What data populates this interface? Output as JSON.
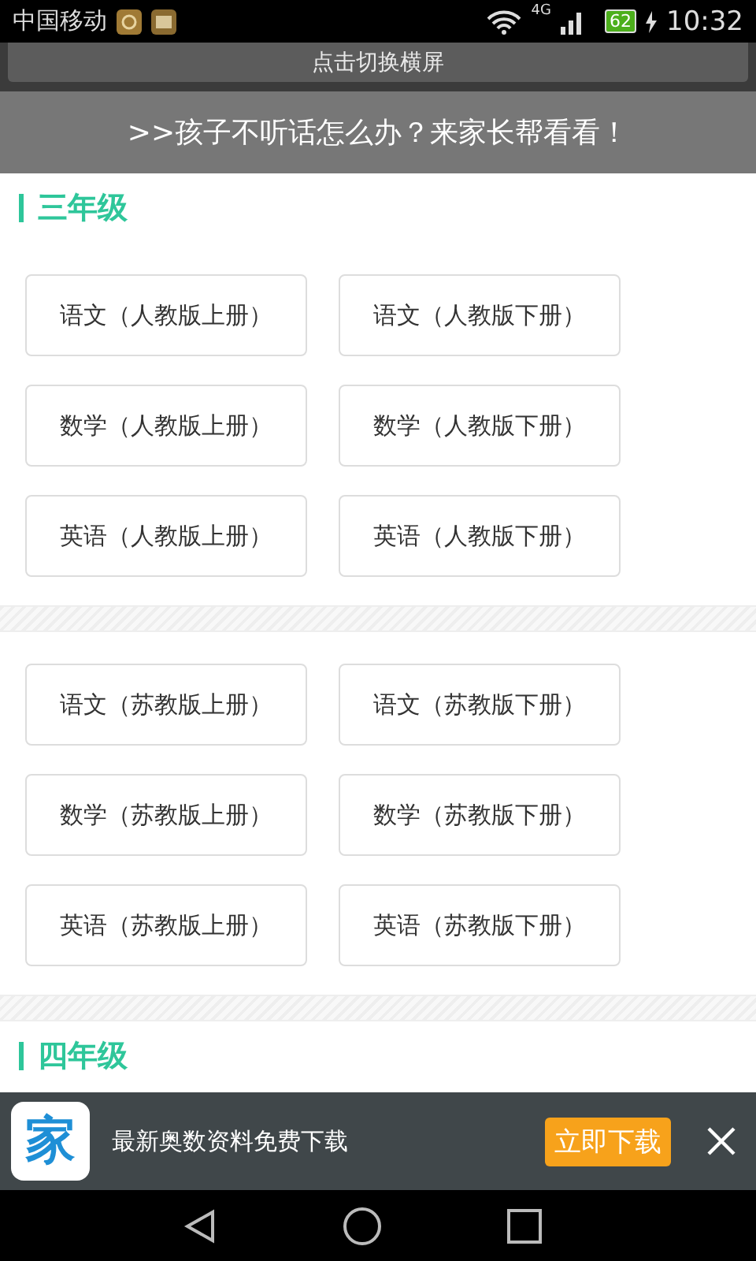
{
  "status_bar": {
    "carrier": "中国移动",
    "network": "4G",
    "battery": "62",
    "time": "10:32"
  },
  "rotate_button": {
    "label": "点击切换横屏"
  },
  "promo_banner": {
    "text": ">>孩子不听话怎么办？来家长帮看看！"
  },
  "sections": [
    {
      "title": "三年级",
      "groups": [
        [
          "语文（人教版上册）",
          "语文（人教版下册）",
          "数学（人教版上册）",
          "数学（人教版下册）",
          "英语（人教版上册）",
          "英语（人教版下册）"
        ],
        [
          "语文（苏教版上册）",
          "语文（苏教版下册）",
          "数学（苏教版上册）",
          "数学（苏教版下册）",
          "英语（苏教版上册）",
          "英语（苏教版下册）"
        ]
      ]
    },
    {
      "title": "四年级"
    }
  ],
  "ad_banner": {
    "app_icon_char": "家",
    "text": "最新奥数资料免费下载",
    "download_button": "立即下载"
  }
}
